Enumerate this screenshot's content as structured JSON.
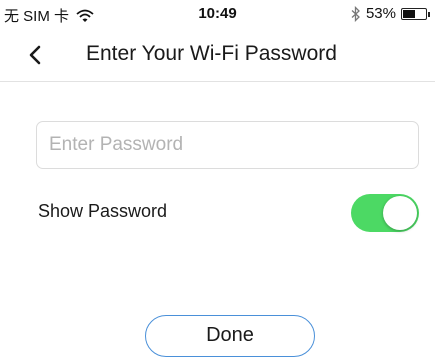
{
  "status_bar": {
    "carrier": "无 SIM 卡",
    "time": "10:49",
    "battery_percent": "53%",
    "battery_level": 0.53,
    "icons": [
      "wifi-icon",
      "bluetooth-icon",
      "battery-icon"
    ]
  },
  "nav": {
    "title": "Enter Your Wi-Fi Password",
    "back_icon": "chevron-left-icon"
  },
  "form": {
    "password_placeholder": "Enter Password",
    "password_value": "",
    "show_password_label": "Show Password",
    "show_password_on": true
  },
  "actions": {
    "done_label": "Done"
  },
  "colors": {
    "toggle_on": "#4cd964",
    "button_border": "#4a90d9",
    "divider": "#e2e2e2"
  }
}
